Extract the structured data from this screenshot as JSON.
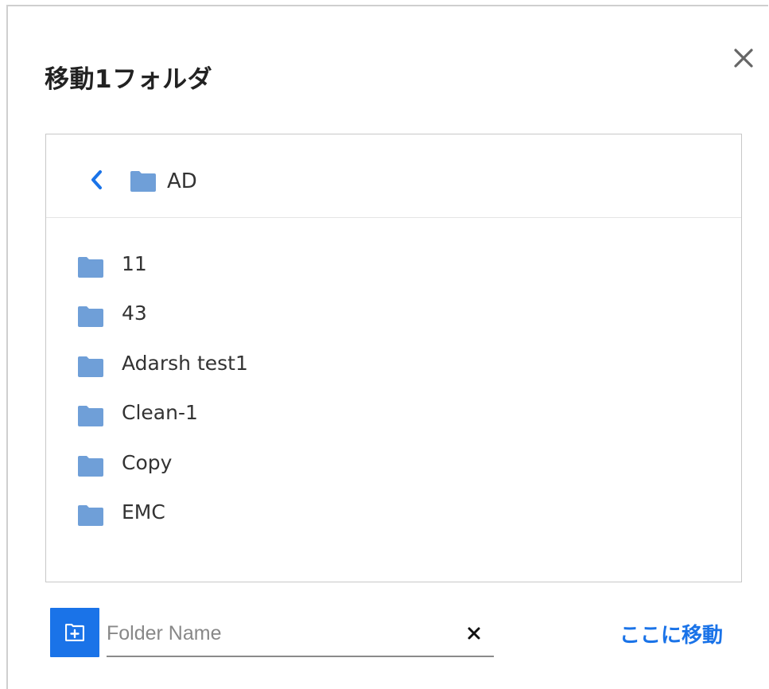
{
  "dialog": {
    "title": "移動1フォルダ",
    "close_icon": "close-icon"
  },
  "browser": {
    "back_icon": "chevron-left-icon",
    "current_folder": "AD",
    "folder_icon_color": "#6f9fd8",
    "folders": [
      "11",
      "43",
      "Adarsh test1",
      "Clean-1",
      "Copy",
      "EMC"
    ]
  },
  "footer": {
    "new_folder_icon": "new-folder-icon",
    "folder_name_placeholder": "Folder Name",
    "folder_name_value": "",
    "clear_icon": "clear-icon",
    "move_here_label": "ここに移動"
  },
  "colors": {
    "accent": "#1a73e8",
    "folder": "#6f9fd8"
  }
}
